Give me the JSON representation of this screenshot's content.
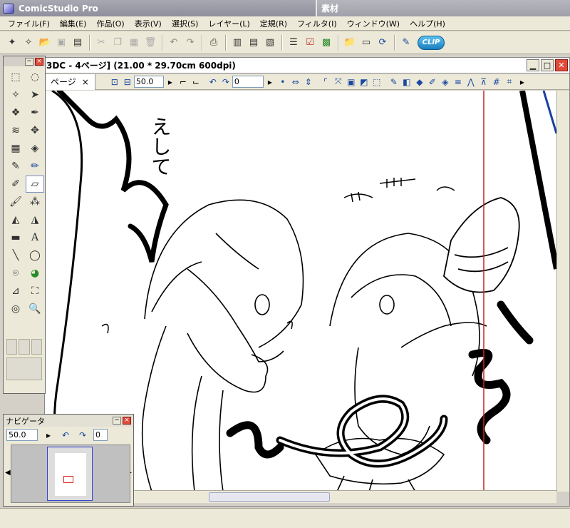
{
  "app": {
    "title": "ComicStudio Pro",
    "material_title": "素材"
  },
  "menu": [
    "ファイル(F)",
    "編集(E)",
    "作品(O)",
    "表示(V)",
    "選択(S)",
    "レイヤー(L)",
    "定規(R)",
    "フィルタ(I)",
    "ウィンドウ(W)",
    "ヘルプ(H)"
  ],
  "toolbar": {
    "logo": "CLIP"
  },
  "document": {
    "title": "3DC - 4ページ] (21.00 * 29.70cm 600dpi)",
    "tab_label": "ページ",
    "tab_close": "×",
    "zoom": "50.0",
    "rotation": "0"
  },
  "canvas": {
    "sfx_text": "えして"
  },
  "navigator": {
    "title": "ナビゲータ",
    "zoom": "50.0",
    "rotation": "0"
  },
  "colors": {
    "accent": "#e04a3a",
    "ruler_line": "#cc2222"
  }
}
